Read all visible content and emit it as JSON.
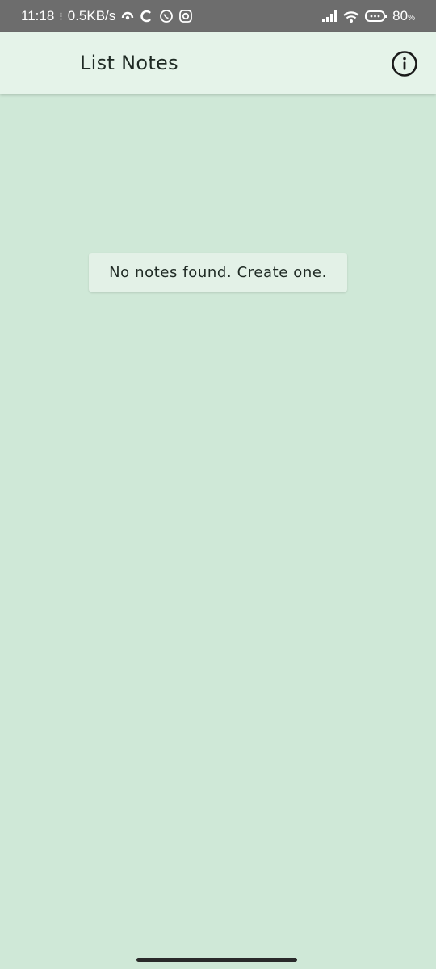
{
  "status_bar": {
    "time": "11:18",
    "separator": "⁝",
    "network_speed": "0.5KB/s",
    "battery": "80",
    "battery_unit": "%",
    "icons": [
      "hotspot-icon",
      "c-app-icon",
      "whatsapp-icon",
      "instagram-icon",
      "signal-icon",
      "wifi-icon",
      "battery-icon"
    ]
  },
  "app_bar": {
    "title": "List Notes",
    "info_icon": "info-icon"
  },
  "main": {
    "empty_message": "No notes found. Create one."
  },
  "colors": {
    "background": "#cfe8d7",
    "app_bar": "#e5f3e9",
    "status_bar": "#6d6d6d",
    "text": "#1f2a24"
  }
}
